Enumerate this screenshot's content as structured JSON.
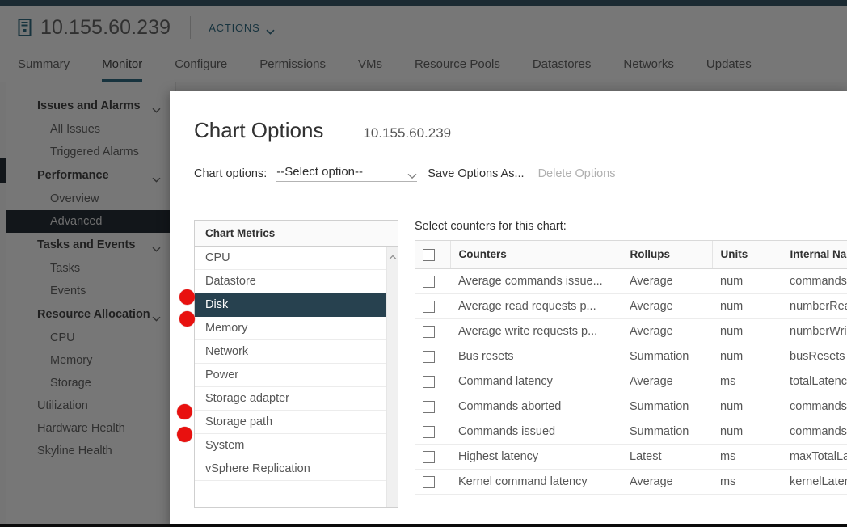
{
  "header": {
    "host_icon": "host-server-icon",
    "title": "10.155.60.239",
    "actions_label": "ACTIONS",
    "actions_chevron": "chevron-down-icon"
  },
  "tabs": [
    {
      "label": "Summary",
      "active": false
    },
    {
      "label": "Monitor",
      "active": true
    },
    {
      "label": "Configure",
      "active": false
    },
    {
      "label": "Permissions",
      "active": false
    },
    {
      "label": "VMs",
      "active": false
    },
    {
      "label": "Resource Pools",
      "active": false
    },
    {
      "label": "Datastores",
      "active": false
    },
    {
      "label": "Networks",
      "active": false
    },
    {
      "label": "Updates",
      "active": false
    }
  ],
  "sidebar": {
    "groups": [
      {
        "label": "Issues and Alarms",
        "chevron": "chevron-down-icon",
        "items": [
          {
            "label": "All Issues",
            "selected": false
          },
          {
            "label": "Triggered Alarms",
            "selected": false
          }
        ]
      },
      {
        "label": "Performance",
        "chevron": "chevron-down-icon",
        "items": [
          {
            "label": "Overview",
            "selected": false
          },
          {
            "label": "Advanced",
            "selected": true
          }
        ]
      },
      {
        "label": "Tasks and Events",
        "chevron": "chevron-down-icon",
        "items": [
          {
            "label": "Tasks",
            "selected": false
          },
          {
            "label": "Events",
            "selected": false
          }
        ]
      },
      {
        "label": "Resource Allocation",
        "chevron": "chevron-down-icon",
        "items": [
          {
            "label": "CPU",
            "selected": false
          },
          {
            "label": "Memory",
            "selected": false
          },
          {
            "label": "Storage",
            "selected": false
          }
        ]
      }
    ],
    "flat_items": [
      {
        "label": "Utilization"
      },
      {
        "label": "Hardware Health"
      },
      {
        "label": "Skyline Health"
      }
    ]
  },
  "modal": {
    "title": "Chart Options",
    "subtitle": "10.155.60.239",
    "options_label": "Chart options:",
    "select_value": "--Select option--",
    "select_chevron": "chevron-down-icon",
    "save_label": "Save Options As...",
    "delete_label": "Delete Options",
    "metrics_header": "Chart Metrics",
    "metrics_scroll_icon": "chevron-up-icon",
    "metrics": [
      {
        "label": "CPU",
        "selected": false,
        "marked": false
      },
      {
        "label": "Datastore",
        "selected": false,
        "marked": true
      },
      {
        "label": "Disk",
        "selected": true,
        "marked": true
      },
      {
        "label": "Memory",
        "selected": false,
        "marked": false
      },
      {
        "label": "Network",
        "selected": false,
        "marked": false
      },
      {
        "label": "Power",
        "selected": false,
        "marked": false
      },
      {
        "label": "Storage adapter",
        "selected": false,
        "marked": true
      },
      {
        "label": "Storage path",
        "selected": false,
        "marked": true
      },
      {
        "label": "System",
        "selected": false,
        "marked": false
      },
      {
        "label": "vSphere Replication",
        "selected": false,
        "marked": false
      }
    ],
    "counters_label": "Select counters for this chart:",
    "counters_columns": [
      "",
      "Counters",
      "Rollups",
      "Units",
      "Internal Nam"
    ],
    "counters_rows": [
      {
        "checked": false,
        "name": "Average commands issue...",
        "rollup": "Average",
        "units": "num",
        "internal": "commands,"
      },
      {
        "checked": false,
        "name": "Average read requests p...",
        "rollup": "Average",
        "units": "num",
        "internal": "numberRea"
      },
      {
        "checked": false,
        "name": "Average write requests p...",
        "rollup": "Average",
        "units": "num",
        "internal": "numberWri"
      },
      {
        "checked": false,
        "name": "Bus resets",
        "rollup": "Summation",
        "units": "num",
        "internal": "busResets"
      },
      {
        "checked": false,
        "name": "Command latency",
        "rollup": "Average",
        "units": "ms",
        "internal": "totalLatenc"
      },
      {
        "checked": false,
        "name": "Commands aborted",
        "rollup": "Summation",
        "units": "num",
        "internal": "commands,"
      },
      {
        "checked": false,
        "name": "Commands issued",
        "rollup": "Summation",
        "units": "num",
        "internal": "commands"
      },
      {
        "checked": false,
        "name": "Highest latency",
        "rollup": "Latest",
        "units": "ms",
        "internal": "maxTotalLa"
      },
      {
        "checked": false,
        "name": "Kernel command latency",
        "rollup": "Average",
        "units": "ms",
        "internal": "kernelLaten"
      }
    ]
  },
  "colors": {
    "accent": "#1b5d78",
    "selected_nav": "#0f1923",
    "selected_metric": "#27414f",
    "annotation": "#e8110f",
    "scrim": "rgba(20,20,20,0.58)"
  }
}
